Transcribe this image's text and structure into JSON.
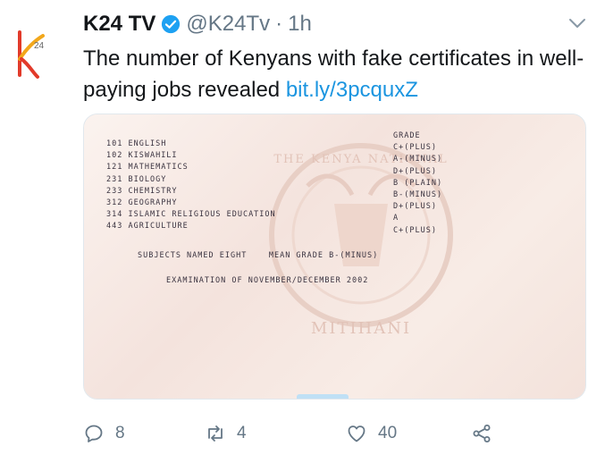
{
  "account": {
    "name": "K24 TV",
    "handle": "@K24Tv",
    "separator": "·",
    "time": "1h",
    "avatar_text": "24"
  },
  "tweet": {
    "text": "The number of Kenyans with fake certificates in well-paying jobs revealed ",
    "link": "bit.ly/3pcquxZ"
  },
  "certificate": {
    "grade_header": "GRADE",
    "subjects": [
      {
        "code": "101",
        "name": "ENGLISH",
        "grade": "C+(PLUS)"
      },
      {
        "code": "102",
        "name": "KISWAHILI",
        "grade": "A-(MINUS)"
      },
      {
        "code": "121",
        "name": "MATHEMATICS",
        "grade": "D+(PLUS)"
      },
      {
        "code": "231",
        "name": "BIOLOGY",
        "grade": "B (PLAIN)"
      },
      {
        "code": "233",
        "name": "CHEMISTRY",
        "grade": "B-(MINUS)"
      },
      {
        "code": "312",
        "name": "GEOGRAPHY",
        "grade": "D+(PLUS)"
      },
      {
        "code": "314",
        "name": "ISLAMIC RELIGIOUS EDUCATION",
        "grade": "A"
      },
      {
        "code": "443",
        "name": "AGRICULTURE",
        "grade": "C+(PLUS)"
      }
    ],
    "subjects_named": "SUBJECTS NAMED EIGHT",
    "mean_grade": "MEAN GRADE B-(MINUS)",
    "examination": "EXAMINATION OF NOVEMBER/DECEMBER 2002",
    "crest_top": "THE KENYA NATIONAL",
    "crest_bottom": "MITIHANI"
  },
  "actions": {
    "replies": "8",
    "retweets": "4",
    "likes": "40"
  },
  "colors": {
    "link": "#1b95e0",
    "muted": "#657786",
    "verified": "#1da1f2"
  }
}
